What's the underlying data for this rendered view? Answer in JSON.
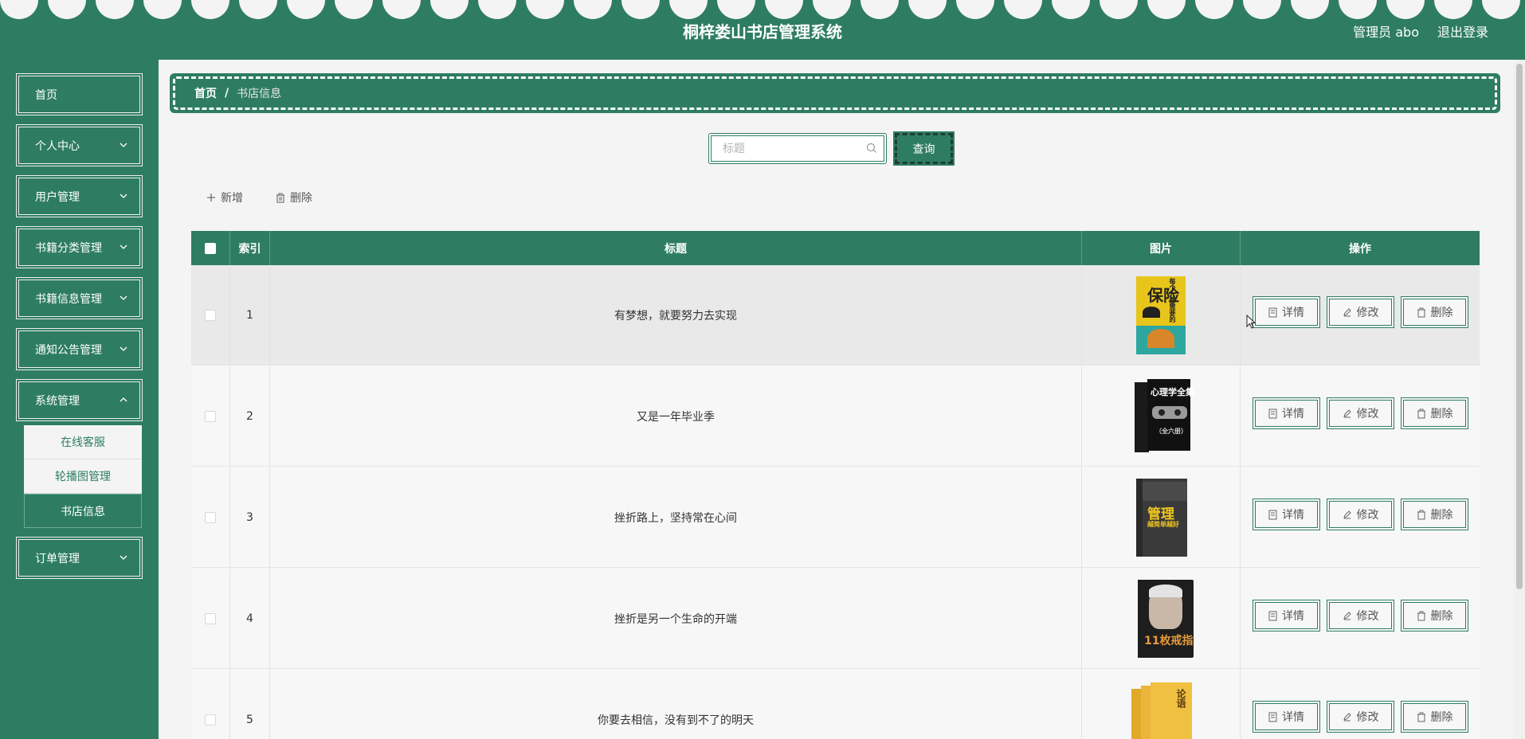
{
  "header": {
    "title": "桐梓娄山书店管理系统",
    "admin": "管理员 abo",
    "logout": "退出登录"
  },
  "sidebar": {
    "items": [
      {
        "label": "首页"
      },
      {
        "label": "个人中心"
      },
      {
        "label": "用户管理"
      },
      {
        "label": "书籍分类管理"
      },
      {
        "label": "书籍信息管理"
      },
      {
        "label": "通知公告管理"
      },
      {
        "label": "系统管理"
      },
      {
        "label": "订单管理"
      }
    ],
    "system_submenu": [
      {
        "label": "在线客服"
      },
      {
        "label": "轮播图管理"
      },
      {
        "label": "书店信息"
      }
    ]
  },
  "breadcrumb": {
    "home": "首页",
    "separator": "/",
    "current": "书店信息"
  },
  "search": {
    "placeholder": "标题",
    "value": "",
    "button": "查询"
  },
  "actions": {
    "add": "新增",
    "delete": "删除"
  },
  "table": {
    "columns": {
      "index": "索引",
      "title": "标题",
      "image": "图片",
      "ops": "操作"
    },
    "rows": [
      {
        "index": "1",
        "title": "有梦想，就要努力去实现",
        "cover": {
          "main": "保险",
          "top": "每个人都需要的"
        }
      },
      {
        "index": "2",
        "title": "又是一年毕业季",
        "cover": {
          "main": "心理学全集",
          "top": "（全六册）"
        }
      },
      {
        "index": "3",
        "title": "挫折路上，坚持常在心间",
        "cover": {
          "main": "管理",
          "top": "越简单越好"
        }
      },
      {
        "index": "4",
        "title": "挫折是另一个生命的开端",
        "cover": {
          "main": "11枚戒指",
          "top": ""
        }
      },
      {
        "index": "5",
        "title": "你要去相信，没有到不了的明天",
        "cover": {
          "main": "论语",
          "top": ""
        }
      }
    ],
    "buttons": {
      "detail": "详情",
      "edit": "修改",
      "delete": "删除"
    }
  },
  "colors": {
    "primary": "#2e7d62",
    "background": "#f4f4f4"
  }
}
